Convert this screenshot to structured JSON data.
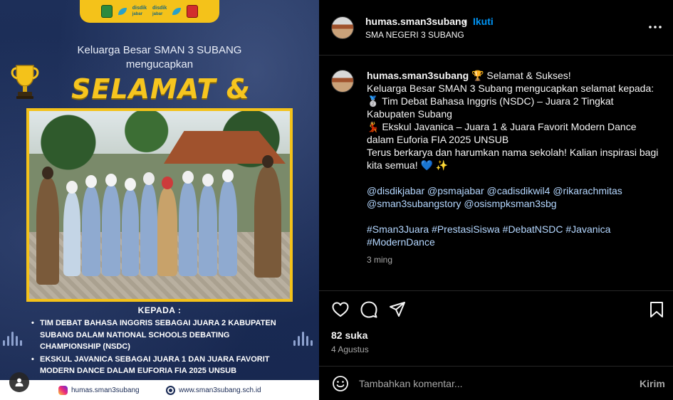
{
  "image": {
    "logo_partner1": "disdik",
    "logo_partner1_sub": "jabar",
    "logo_partner2": "disdik",
    "logo_partner2_sub": "jabar",
    "greeting_line1": "Keluarga Besar SMAN 3 SUBANG",
    "greeting_line2": "mengucapkan",
    "headline": "SELAMAT & SUKSES",
    "to_label": "KEPADA :",
    "recipients": [
      "TIM DEBAT BAHASA INGGRIS SEBAGAI JUARA 2 KABUPATEN SUBANG DALAM NATIONAL SCHOOLS DEBATING CHAMPIONSHIP (NSDC)",
      "EKSKUL JAVANICA SEBAGAI JUARA 1 DAN JUARA FAVORIT MODERN DANCE DALAM EUFORIA FIA 2025 UNSUB"
    ],
    "footer_instagram": "humas.sman3subang",
    "footer_website": "www.sman3subang.sch.id",
    "colors": {
      "navy": "#1a2b55",
      "gold": "#f4c21a"
    }
  },
  "header": {
    "username": "humas.sman3subang",
    "separator": "•",
    "follow_label": "Ikuti",
    "location": "SMA NEGERI 3 SUBANG"
  },
  "caption": {
    "username": "humas.sman3subang",
    "line1": "🏆 Selamat & Sukses!",
    "line2": "Keluarga Besar SMAN 3 Subang mengucapkan selamat kepada:",
    "line3": "🥈 Tim Debat Bahasa Inggris (NSDC) – Juara 2 Tingkat Kabupaten Subang",
    "line4": "💃 Ekskul Javanica – Juara 1 & Juara Favorit Modern Dance dalam Euforia FIA 2025 UNSUB",
    "line5": "Terus berkarya dan harumkan nama sekolah! Kalian inspirasi bagi kita semua! 💙 ✨",
    "mentions": [
      "@disdikjabar",
      "@psmajabar",
      "@cadisdikwil4",
      "@rikarachmitas",
      "@sman3subangstory",
      "@osismpksman3sbg"
    ],
    "hashtags": [
      "#Sman3Juara",
      "#PrestasiSiswa",
      "#DebatNSDC",
      "#Javanica",
      "#ModernDance"
    ],
    "time_ago": "3 ming"
  },
  "actions": {
    "likes": "82 suka",
    "date": "4 Agustus",
    "icons": [
      "heart-icon",
      "comment-icon",
      "share-icon",
      "bookmark-icon"
    ]
  },
  "comment": {
    "placeholder": "Tambahkan komentar...",
    "post_label": "Kirim"
  }
}
